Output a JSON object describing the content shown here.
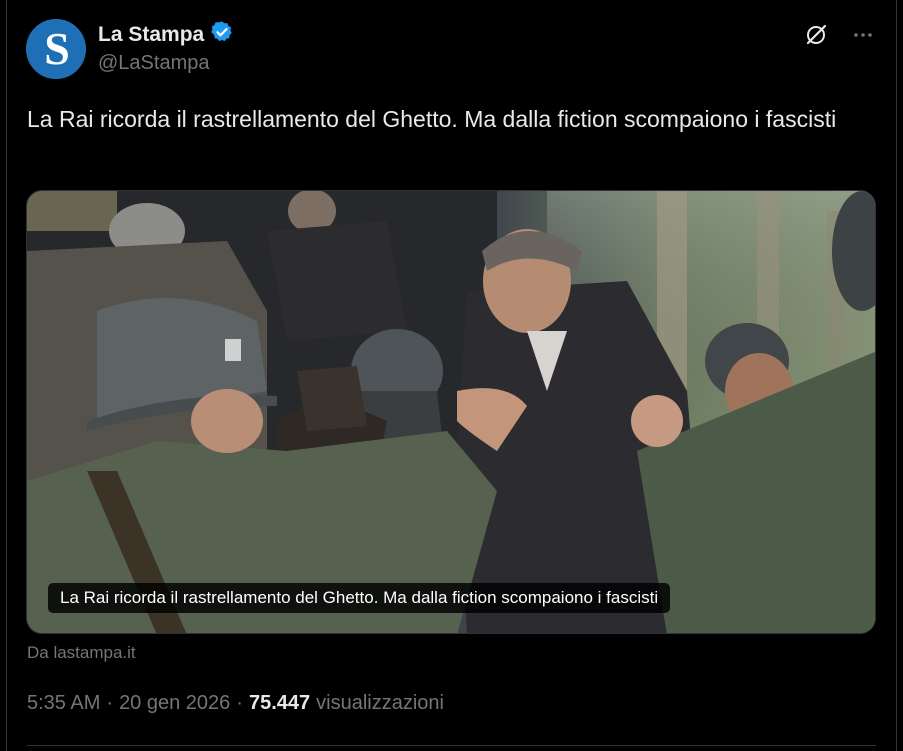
{
  "author": {
    "display_name": "La Stampa",
    "handle": "@LaStampa",
    "verified": true,
    "avatar_letter": "S"
  },
  "header_icons": [
    "grok-icon",
    "more-options-icon"
  ],
  "tweet": {
    "text": "La Rai ricorda il rastrellamento del Ghetto. Ma dalla fiction scompaiono i fascisti"
  },
  "card": {
    "caption": "La Rai ricorda il rastrellamento del Ghetto. Ma dalla fiction scompaiono i fascisti",
    "source": "Da lastampa.it"
  },
  "meta": {
    "time": "5:35 AM",
    "separator": "·",
    "date": "20 gen 2026",
    "views_count": "75.447",
    "views_label": "visualizzazioni"
  },
  "colors": {
    "background": "#000000",
    "text_primary": "#e7e9ea",
    "text_secondary": "#71767b",
    "verified_badge": "#1d9bf0",
    "avatar_bg": "#1e6fb5"
  }
}
